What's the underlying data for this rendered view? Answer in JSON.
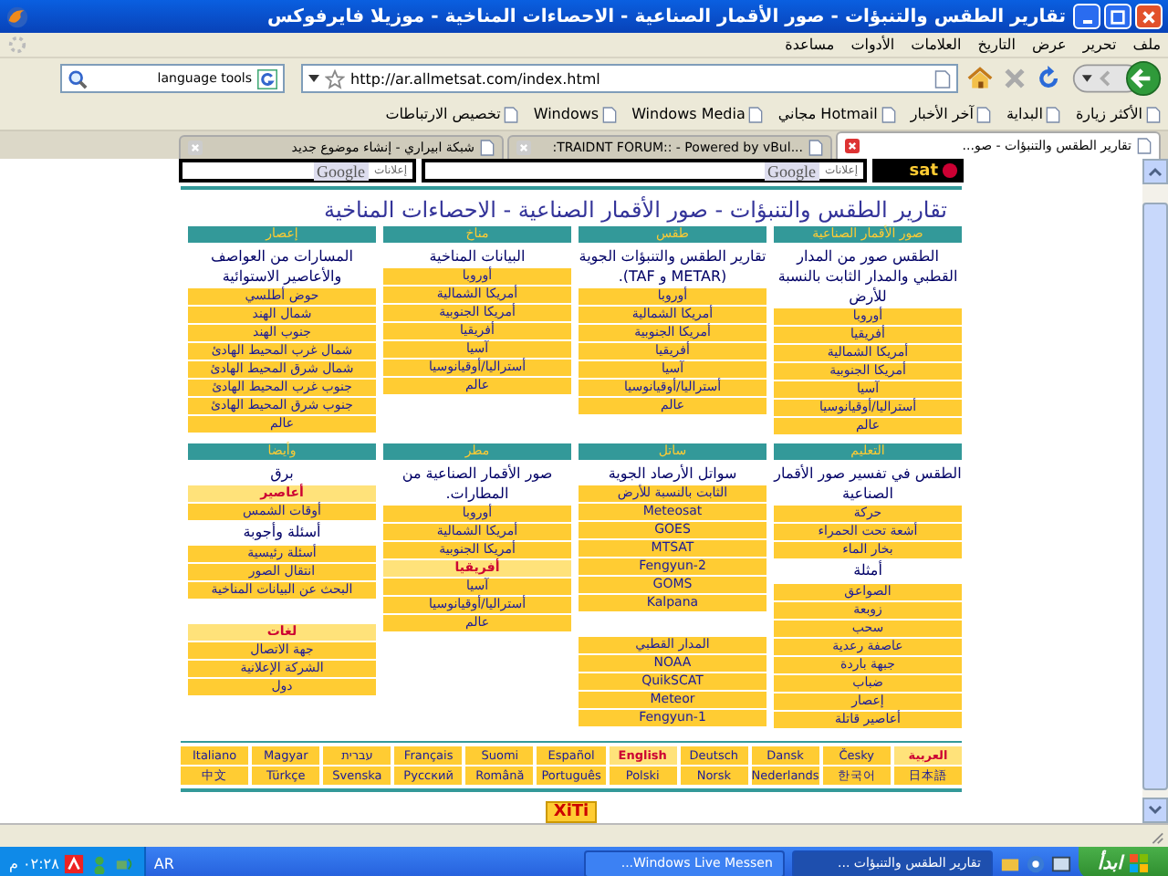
{
  "window": {
    "title": "تقارير الطقس والتنبؤات - صور الأقمار الصناعية - الاحصاءات المناخية - موزيلا فايرفوكس"
  },
  "menu": [
    "ملف",
    "تحرير",
    "عرض",
    "التاريخ",
    "العلامات",
    "الأدوات",
    "مساعدة"
  ],
  "toolbar": {
    "url": "http://ar.allmetsat.com/index.html",
    "search": "language tools"
  },
  "bookmarks": [
    "الأكثر زيارة",
    "البداية",
    "آخر الأخبار",
    "Hotmail مجاني",
    "Windows Media",
    "Windows",
    "تخصيص الارتباطات"
  ],
  "tabs": [
    {
      "label": "تقارير الطقس والتنبؤات - صو...",
      "selected": true
    },
    {
      "label": "...TRAIDNT FORUM:: - Powered by vBul:",
      "selected": false
    },
    {
      "label": "شبكة ابيراري - إنشاء موضوع جديد",
      "selected": false
    }
  ],
  "page": {
    "ads": [
      {
        "brand": "Google",
        "note": "إعلانات"
      },
      {
        "brand": "Google",
        "note": "إعلانات"
      }
    ],
    "logo": "sat",
    "title": "تقارير الطقس والتنبؤات - صور الأقمار الصناعية - الاحصاءات المناخية",
    "sections": [
      {
        "columns": [
          {
            "header": "صور الأقمار الصناعية",
            "description": "الطقس صور من المدار القطبي والمدار الثابت بالنسبة للأرض",
            "groups": [
              [
                {
                  "label": "أوروبا",
                  "kind": "link",
                  "highlighted": false
                },
                {
                  "label": "أفريقيا",
                  "kind": "link",
                  "highlighted": false
                },
                {
                  "label": "أمريكا الشمالية",
                  "kind": "link",
                  "highlighted": false
                },
                {
                  "label": "أمريكا الجنوبية",
                  "kind": "link",
                  "highlighted": false
                },
                {
                  "label": "آسيا",
                  "kind": "link",
                  "highlighted": false
                },
                {
                  "label": "أستراليا/أوقيانوسيا",
                  "kind": "link",
                  "highlighted": false
                },
                {
                  "label": "عالم",
                  "kind": "link",
                  "highlighted": false
                }
              ]
            ]
          },
          {
            "header": "طقس",
            "description": "تقارير الطقس والتنبؤات الجوية (METAR و TAF).",
            "groups": [
              [
                {
                  "label": "أوروبا",
                  "kind": "link",
                  "highlighted": false
                },
                {
                  "label": "أمريكا الشمالية",
                  "kind": "link",
                  "highlighted": false
                },
                {
                  "label": "أمريكا الجنوبية",
                  "kind": "link",
                  "highlighted": false
                },
                {
                  "label": "أفريقيا",
                  "kind": "link",
                  "highlighted": false
                },
                {
                  "label": "آسيا",
                  "kind": "link",
                  "highlighted": false
                },
                {
                  "label": "أستراليا/أوقيانوسيا",
                  "kind": "link",
                  "highlighted": false
                },
                {
                  "label": "عالم",
                  "kind": "link",
                  "highlighted": false
                }
              ]
            ]
          },
          {
            "header": "مناخ",
            "description": "البيانات المناخية",
            "groups": [
              [
                {
                  "label": "أوروبا",
                  "kind": "link",
                  "highlighted": false
                },
                {
                  "label": "أمريكا الشمالية",
                  "kind": "link",
                  "highlighted": false
                },
                {
                  "label": "أمريكا الجنوبية",
                  "kind": "link",
                  "highlighted": false
                },
                {
                  "label": "أفريقيا",
                  "kind": "link",
                  "highlighted": false
                },
                {
                  "label": "آسيا",
                  "kind": "link",
                  "highlighted": false
                },
                {
                  "label": "أستراليا/أوقيانوسيا",
                  "kind": "link",
                  "highlighted": false
                },
                {
                  "label": "عالم",
                  "kind": "link",
                  "highlighted": false
                }
              ]
            ]
          },
          {
            "header": "إعصار",
            "description": "المسارات من العواصف والأعاصير الاستوائية",
            "groups": [
              [
                {
                  "label": "حوض أطلسي",
                  "kind": "link",
                  "highlighted": false
                },
                {
                  "label": "شمال الهند",
                  "kind": "link",
                  "highlighted": false
                },
                {
                  "label": "جنوب الهند",
                  "kind": "link",
                  "highlighted": false
                },
                {
                  "label": "شمال غرب المحيط الهادئ",
                  "kind": "link",
                  "highlighted": false
                },
                {
                  "label": "شمال شرق المحيط الهادئ",
                  "kind": "link",
                  "highlighted": false
                },
                {
                  "label": "جنوب غرب المحيط الهادئ",
                  "kind": "link",
                  "highlighted": false
                },
                {
                  "label": "جنوب شرق المحيط الهادئ",
                  "kind": "link",
                  "highlighted": false
                },
                {
                  "label": "عالم",
                  "kind": "link",
                  "highlighted": false
                }
              ]
            ]
          }
        ]
      },
      {
        "columns": [
          {
            "header": "التعليم",
            "description": "الطقس في تفسير صور الأقمار الصناعية",
            "groups": [
              [
                {
                  "label": "حركة",
                  "kind": "link",
                  "highlighted": false
                },
                {
                  "label": "أشعة تحت الحمراء",
                  "kind": "link",
                  "highlighted": false
                },
                {
                  "label": "بخار الماء",
                  "kind": "link",
                  "highlighted": false
                },
                {
                  "label": "أمثلة",
                  "kind": "heading"
                },
                {
                  "label": "الصواعق",
                  "kind": "link",
                  "highlighted": false
                },
                {
                  "label": "زوبعة",
                  "kind": "link",
                  "highlighted": false
                },
                {
                  "label": "سحب",
                  "kind": "link",
                  "highlighted": false
                },
                {
                  "label": "عاصفة رعدية",
                  "kind": "link",
                  "highlighted": false
                },
                {
                  "label": "جبهة باردة",
                  "kind": "link",
                  "highlighted": false
                },
                {
                  "label": "ضباب",
                  "kind": "link",
                  "highlighted": false
                },
                {
                  "label": "إعصار",
                  "kind": "link",
                  "highlighted": false
                },
                {
                  "label": "أعاصير قاتلة",
                  "kind": "link",
                  "highlighted": false
                }
              ]
            ]
          },
          {
            "header": "ساتل",
            "description": "سواتل الأرصاد الجوية",
            "groups": [
              [
                {
                  "label": "الثابت بالنسبة للأرض",
                  "kind": "link",
                  "highlighted": false
                },
                {
                  "label": "Meteosat",
                  "kind": "link",
                  "highlighted": false
                },
                {
                  "label": "GOES",
                  "kind": "link",
                  "highlighted": false
                },
                {
                  "label": "MTSAT",
                  "kind": "link",
                  "highlighted": false
                },
                {
                  "label": "Fengyun-2",
                  "kind": "link",
                  "highlighted": false
                },
                {
                  "label": "GOMS",
                  "kind": "link",
                  "highlighted": false
                },
                {
                  "label": "Kalpana",
                  "kind": "link",
                  "highlighted": false
                }
              ],
              [
                {
                  "label": "المدار القطبي",
                  "kind": "link",
                  "highlighted": false
                },
                {
                  "label": "NOAA",
                  "kind": "link",
                  "highlighted": false
                },
                {
                  "label": "QuikSCAT",
                  "kind": "link",
                  "highlighted": false
                },
                {
                  "label": "Meteor",
                  "kind": "link",
                  "highlighted": false
                },
                {
                  "label": "Fengyun-1",
                  "kind": "link",
                  "highlighted": false
                }
              ]
            ]
          },
          {
            "header": "مطر",
            "description": "صور الأقمار الصناعية من المطارات.",
            "groups": [
              [
                {
                  "label": "أوروبا",
                  "kind": "link",
                  "highlighted": false
                },
                {
                  "label": "أمريكا الشمالية",
                  "kind": "link",
                  "highlighted": false
                },
                {
                  "label": "أمريكا الجنوبية",
                  "kind": "link",
                  "highlighted": false
                },
                {
                  "label": "أفريقيا",
                  "kind": "link",
                  "highlighted": true
                },
                {
                  "label": "آسيا",
                  "kind": "link",
                  "highlighted": false
                },
                {
                  "label": "أستراليا/أوقيانوسيا",
                  "kind": "link",
                  "highlighted": false
                },
                {
                  "label": "عالم",
                  "kind": "link",
                  "highlighted": false
                }
              ]
            ]
          },
          {
            "header": "وأيضا",
            "description": "برق",
            "groups": [
              [
                {
                  "label": "أعاصير",
                  "kind": "link",
                  "highlighted": true
                },
                {
                  "label": "أوقات الشمس",
                  "kind": "link",
                  "highlighted": false
                },
                {
                  "label": "أسئلة وأجوبة",
                  "kind": "heading"
                },
                {
                  "label": "أسئلة رئيسية",
                  "kind": "link",
                  "highlighted": false
                },
                {
                  "label": "انتقال الصور",
                  "kind": "link",
                  "highlighted": false
                },
                {
                  "label": "البحث عن البيانات المناخية",
                  "kind": "link",
                  "highlighted": false
                }
              ],
              [
                {
                  "label": "لغات",
                  "kind": "link",
                  "highlighted": true
                },
                {
                  "label": "جهة الاتصال",
                  "kind": "link",
                  "highlighted": false
                },
                {
                  "label": "الشركة الإعلانية",
                  "kind": "link",
                  "highlighted": false
                },
                {
                  "label": "دول",
                  "kind": "link",
                  "highlighted": false
                }
              ]
            ]
          }
        ]
      }
    ],
    "languages": [
      [
        {
          "label": "العربية",
          "highlighted": true
        },
        {
          "label": "Česky",
          "highlighted": false
        },
        {
          "label": "Dansk",
          "highlighted": false
        },
        {
          "label": "Deutsch",
          "highlighted": false
        },
        {
          "label": "English",
          "highlighted": true
        },
        {
          "label": "Español",
          "highlighted": false
        },
        {
          "label": "Suomi",
          "highlighted": false
        },
        {
          "label": "Français",
          "highlighted": false
        },
        {
          "label": "עברית",
          "highlighted": false
        },
        {
          "label": "Magyar",
          "highlighted": false
        },
        {
          "label": "Italiano",
          "highlighted": false
        }
      ],
      [
        {
          "label": "日本語",
          "highlighted": false
        },
        {
          "label": "한국어",
          "highlighted": false
        },
        {
          "label": "Nederlands",
          "highlighted": false
        },
        {
          "label": "Norsk",
          "highlighted": false
        },
        {
          "label": "Polski",
          "highlighted": false
        },
        {
          "label": "Português",
          "highlighted": false
        },
        {
          "label": "Română",
          "highlighted": false
        },
        {
          "label": "Русский",
          "highlighted": false
        },
        {
          "label": "Svenska",
          "highlighted": false
        },
        {
          "label": "Türkçe",
          "highlighted": false
        },
        {
          "label": "中文",
          "highlighted": false
        }
      ]
    ],
    "counter": "XiTi"
  },
  "taskbar": {
    "start": "ابدأ",
    "tasks": [
      {
        "label": "تقارير الطقس والتنبؤات ...",
        "selected": true
      },
      {
        "label": "Windows Live Messen...",
        "selected": false
      }
    ],
    "language": "AR",
    "clock": "٠٢:٢٨ م"
  }
}
